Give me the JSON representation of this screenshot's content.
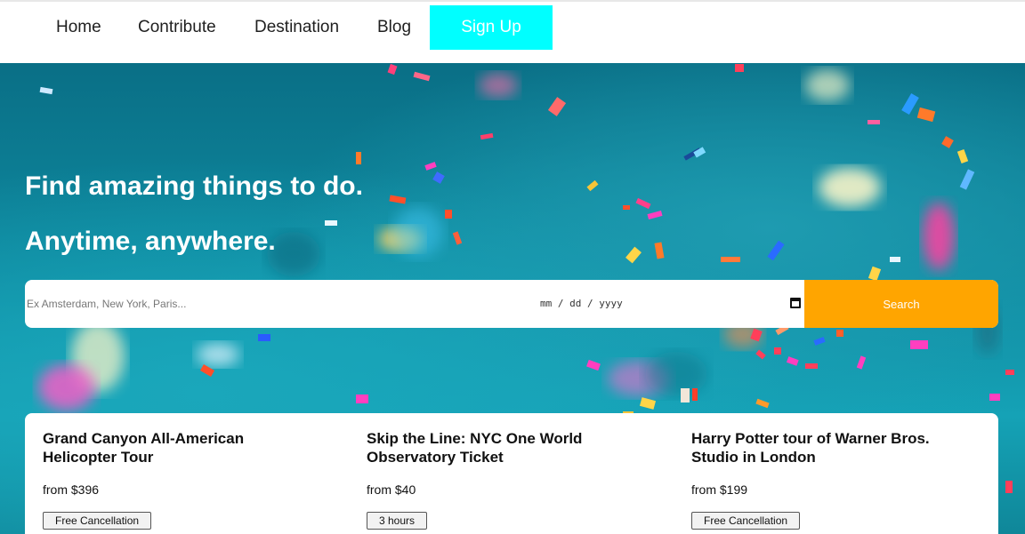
{
  "nav": {
    "items": [
      "Home",
      "Contribute",
      "Destination",
      "Blog"
    ],
    "signup_label": "Sign Up"
  },
  "hero": {
    "headline_line1": "Find amazing things to do.",
    "headline_line2": "Anytime, anywhere."
  },
  "search": {
    "placeholder": "Ex Amsterdam, New York, Paris...",
    "date_placeholder": "mm / dd / yyyy",
    "button_label": "Search"
  },
  "cards": [
    {
      "title": "Grand Canyon All-American Helicopter Tour",
      "price": "from $396",
      "tag": "Free Cancellation"
    },
    {
      "title": "Skip the Line: NYC One World Observatory Ticket",
      "price": "from $40",
      "tag": "3 hours"
    },
    {
      "title": "Harry Potter tour of Warner Bros. Studio in London",
      "price": "from $199",
      "tag": "Free Cancellation"
    }
  ],
  "colors": {
    "signup_bg": "#00ffff",
    "search_button_bg": "#ffa500",
    "hero_teal": "#0e8aa0"
  }
}
